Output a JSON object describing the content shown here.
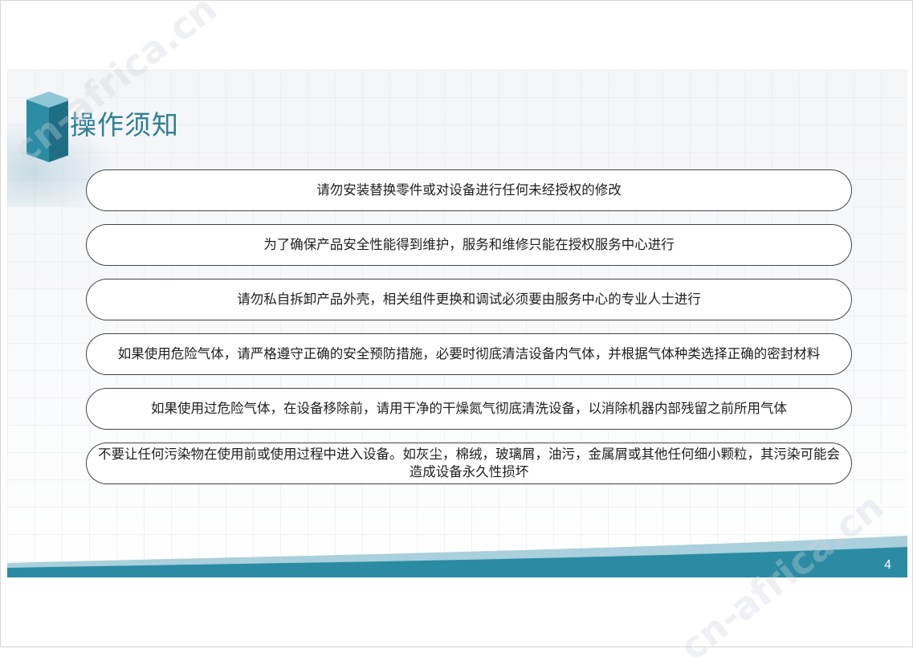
{
  "slide": {
    "title": "操作须知",
    "page_number": "4",
    "watermark": "cn-africa.cn"
  },
  "notes": [
    "请勿安装替换零件或对设备进行任何未经授权的修改",
    "为了确保产品安全性能得到维护，服务和维修只能在授权服务中心进行",
    "请勿私自拆卸产品外壳，相关组件更换和调试必须要由服务中心的专业人士进行",
    "如果使用危险气体，请严格遵守正确的安全预防措施，必要时彻底清洁设备内气体，并根据气体种类选择正确的密封材料",
    "如果使用过危险气体，在设备移除前，请用干净的干燥氮气彻底清洗设备，以消除机器内部残留之前所用气体",
    "不要让任何污染物在使用前或使用过程中进入设备。如灰尘，棉绒，玻璃屑，油污，金属屑或其他任何细小颗粒，其污染可能会造成设备永久性损坏"
  ],
  "colors": {
    "title": "#2f7f93",
    "band_dark": "#2b8ba3",
    "band_light": "#a9d0dc",
    "outline": "#444444"
  }
}
